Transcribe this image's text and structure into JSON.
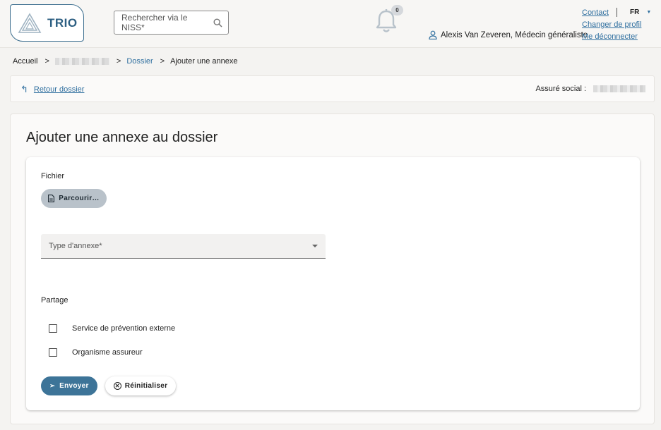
{
  "header": {
    "logo_text": "TRIO",
    "search_placeholder": "Rechercher via le NISS*",
    "notifications_count": "0",
    "user_label": "Alexis Van Zeveren, Médecin généraliste",
    "links": {
      "contact": "Contact",
      "change_profile": "Changer de profil",
      "logout": "Me déconnecter"
    },
    "language": "FR"
  },
  "breadcrumb": {
    "home": "Accueil",
    "separator": ">",
    "dossier": "Dossier",
    "current": "Ajouter une annexe"
  },
  "subbar": {
    "back_label": "Retour dossier",
    "insured_label": "Assuré social :"
  },
  "form": {
    "title": "Ajouter une annexe au dossier",
    "file_label": "Fichier",
    "browse_label": "Parcourir…",
    "annex_type_placeholder": "Type d'annexe*",
    "sharing_label": "Partage",
    "options": [
      {
        "label": "Service de prévention externe",
        "checked": false
      },
      {
        "label": "Organisme assureur",
        "checked": false
      }
    ],
    "submit_label": "Envoyer",
    "reset_label": "Réinitialiser"
  },
  "colors": {
    "primary": "#3d7498",
    "link": "#2f6f9f",
    "background": "#f4f3f1"
  }
}
